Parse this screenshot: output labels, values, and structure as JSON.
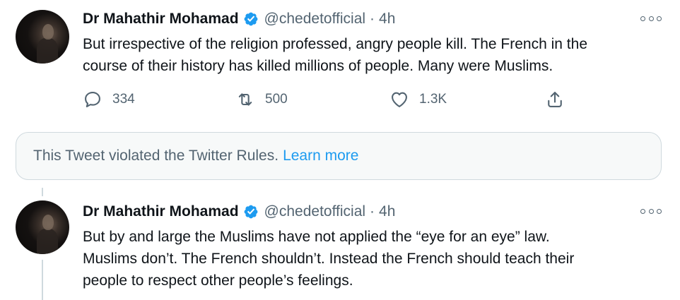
{
  "tweets": [
    {
      "author": {
        "name": "Dr Mahathir Mohamad",
        "handle": "@chedetofficial",
        "verified": true
      },
      "separator": "·",
      "time": "4h",
      "text_lines": [
        "But irrespective of the religion professed, angry people kill. The French in the",
        "course of their history has killed millions of people. Many were Muslims."
      ],
      "actions": {
        "replies": "334",
        "retweets": "500",
        "likes": "1.3K"
      }
    },
    {
      "author": {
        "name": "Dr Mahathir Mohamad",
        "handle": "@chedetofficial",
        "verified": true
      },
      "separator": "·",
      "time": "4h",
      "text_lines": [
        "But by and large the Muslims have not applied the “eye for an eye” law.",
        "Muslims don’t. The French shouldn’t. Instead the French should teach their",
        "people to respect other people’s feelings."
      ]
    }
  ],
  "notice": {
    "text": "This Tweet violated the Twitter Rules.",
    "link": "Learn more"
  },
  "icons": [
    "reply-icon",
    "retweet-icon",
    "like-icon",
    "share-icon",
    "more-icon",
    "verified-icon"
  ],
  "colors": {
    "accent": "#1d9bf0",
    "secondary_text": "#536471",
    "border": "#cfd9de",
    "notice_bg": "#f7f9f9"
  }
}
